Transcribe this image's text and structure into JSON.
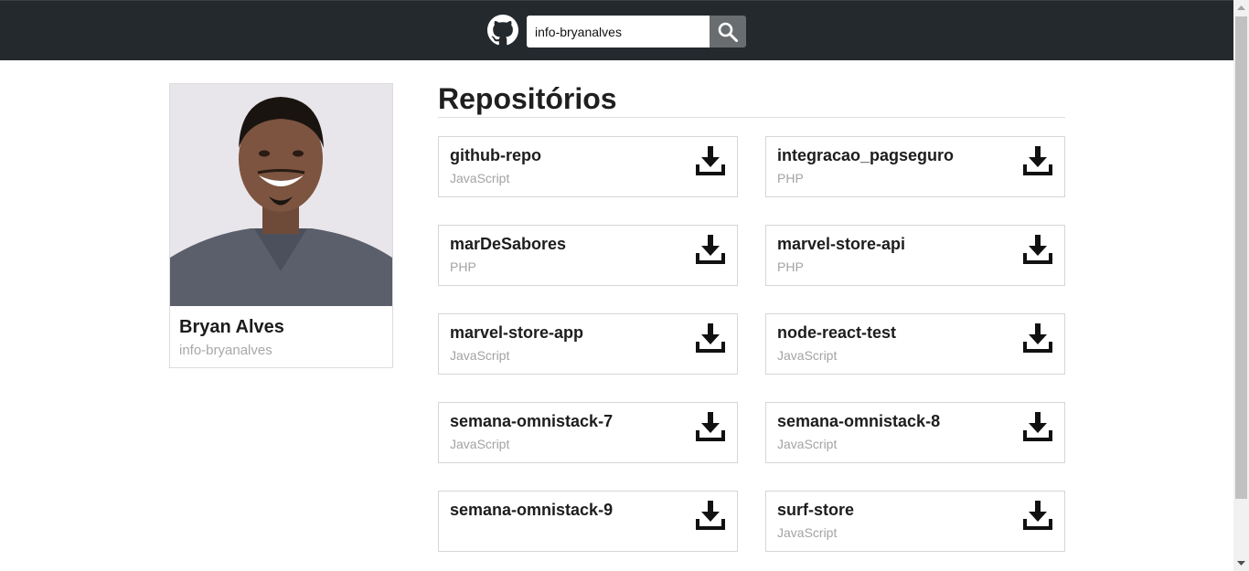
{
  "header": {
    "search": {
      "value": "info-bryanalves",
      "placeholder": ""
    }
  },
  "profile": {
    "name": "Bryan Alves",
    "login": "info-bryanalves"
  },
  "repos": {
    "title": "Repositórios",
    "items": [
      {
        "name": "github-repo",
        "language": "JavaScript"
      },
      {
        "name": "integracao_pagseguro",
        "language": "PHP"
      },
      {
        "name": "marDeSabores",
        "language": "PHP"
      },
      {
        "name": "marvel-store-api",
        "language": "PHP"
      },
      {
        "name": "marvel-store-app",
        "language": "JavaScript"
      },
      {
        "name": "node-react-test",
        "language": "JavaScript"
      },
      {
        "name": "semana-omnistack-7",
        "language": "JavaScript"
      },
      {
        "name": "semana-omnistack-8",
        "language": "JavaScript"
      },
      {
        "name": "semana-omnistack-9",
        "language": ""
      },
      {
        "name": "surf-store",
        "language": "JavaScript"
      }
    ]
  },
  "icons": {
    "logo": "github-icon",
    "search": "search-icon",
    "download": "download-icon"
  },
  "colors": {
    "header_bg": "#24292e",
    "search_button": "#6a6d70",
    "language_text": "#a3a3a3"
  }
}
